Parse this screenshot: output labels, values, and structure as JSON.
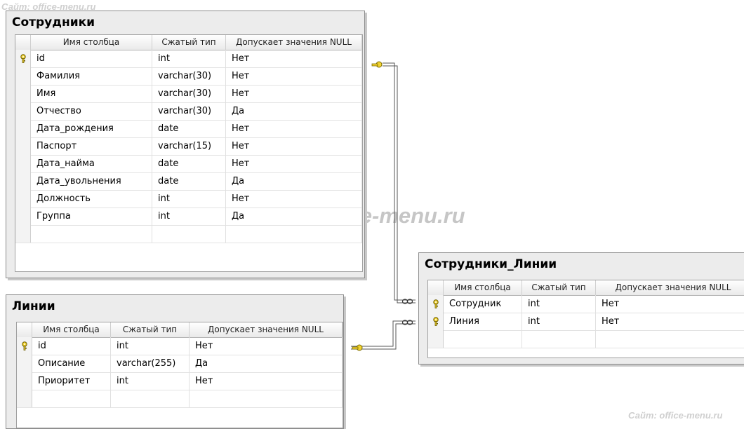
{
  "watermarks": {
    "top": "Сайт: office-menu.ru",
    "center": "Сайт: office-menu.ru",
    "bottom": "Сайт: office-menu.ru"
  },
  "columns_header": {
    "name": "Имя столбца",
    "type": "Сжатый тип",
    "nullable": "Допускает значения NULL"
  },
  "tables": {
    "employees": {
      "title": "Сотрудники",
      "rows": [
        {
          "name": "id",
          "type": "int",
          "nullable": "Нет",
          "key": true
        },
        {
          "name": "Фамилия",
          "type": "varchar(30)",
          "nullable": "Нет",
          "key": false
        },
        {
          "name": "Имя",
          "type": "varchar(30)",
          "nullable": "Нет",
          "key": false
        },
        {
          "name": "Отчество",
          "type": "varchar(30)",
          "nullable": "Да",
          "key": false
        },
        {
          "name": "Дата_рождения",
          "type": "date",
          "nullable": "Нет",
          "key": false
        },
        {
          "name": "Паспорт",
          "type": "varchar(15)",
          "nullable": "Нет",
          "key": false
        },
        {
          "name": "Дата_найма",
          "type": "date",
          "nullable": "Нет",
          "key": false
        },
        {
          "name": "Дата_увольнения",
          "type": "date",
          "nullable": "Да",
          "key": false
        },
        {
          "name": "Должность",
          "type": "int",
          "nullable": "Нет",
          "key": false
        },
        {
          "name": "Группа",
          "type": "int",
          "nullable": "Да",
          "key": false
        }
      ]
    },
    "lines": {
      "title": "Линии",
      "rows": [
        {
          "name": "id",
          "type": "int",
          "nullable": "Нет",
          "key": true
        },
        {
          "name": "Описание",
          "type": "varchar(255)",
          "nullable": "Да",
          "key": false
        },
        {
          "name": "Приоритет",
          "type": "int",
          "nullable": "Нет",
          "key": false
        }
      ]
    },
    "employee_lines": {
      "title": "Сотрудники_Линии",
      "rows": [
        {
          "name": "Сотрудник",
          "type": "int",
          "nullable": "Нет",
          "key": true
        },
        {
          "name": "Линия",
          "type": "int",
          "nullable": "Нет",
          "key": true
        }
      ]
    }
  },
  "icons": {
    "primary_key": "key-icon",
    "relationship_one": "key-icon",
    "relationship_many": "infinity-icon"
  },
  "colors": {
    "key": "#e8c51a",
    "border": "#8c8c8c",
    "panel": "#ececec"
  }
}
